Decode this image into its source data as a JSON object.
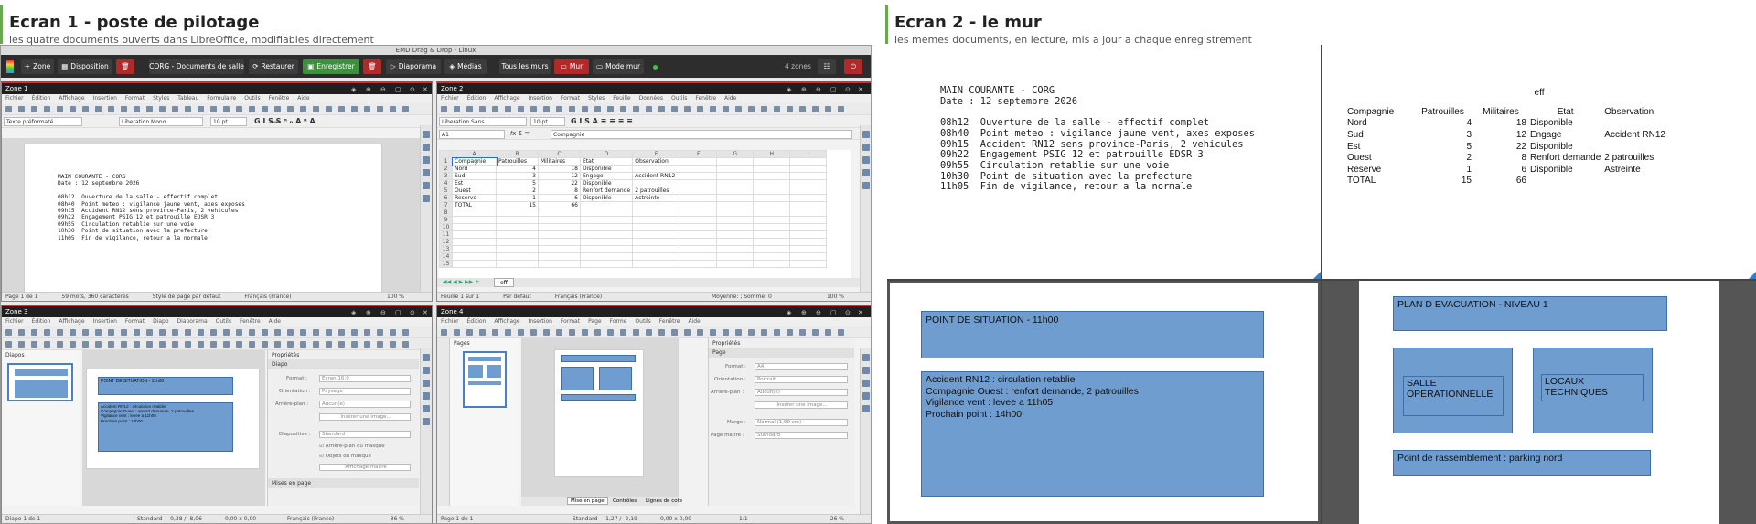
{
  "left_header": {
    "title": "Ecran 1 - poste de pilotage",
    "subtitle": "les quatre documents ouverts dans LibreOffice, modifiables directement"
  },
  "right_header": {
    "title": "Ecran 2 - le mur",
    "subtitle": "les memes documents, en lecture, mis a jour a chaque enregistrement"
  },
  "app": {
    "window_title": "EMD Drag & Drop - Linux",
    "toolbar": {
      "zone": "Zone",
      "disposition": "Disposition",
      "doc_select": "CORG - Documents de salle",
      "restaurer": "Restaurer",
      "enregistrer": "Enregistrer",
      "diaporama": "Diaporama",
      "medias": "Médias",
      "tous_les_murs": "Tous les murs",
      "mur": "Mur",
      "mode_mur": "Mode mur",
      "zone_count": "4 zones"
    },
    "menus_writer": [
      "Fichier",
      "Édition",
      "Affichage",
      "Insertion",
      "Format",
      "Styles",
      "Tableau",
      "Formulaire",
      "Outils",
      "Fenêtre",
      "Aide"
    ],
    "menus_calc": [
      "Fichier",
      "Édition",
      "Affichage",
      "Insertion",
      "Format",
      "Styles",
      "Feuille",
      "Données",
      "Outils",
      "Fenêtre",
      "Aide"
    ],
    "menus_impress": [
      "Fichier",
      "Édition",
      "Affichage",
      "Insertion",
      "Format",
      "Diapo",
      "Diaporama",
      "Outils",
      "Fenêtre",
      "Aide"
    ],
    "menus_draw": [
      "Fichier",
      "Édition",
      "Affichage",
      "Insertion",
      "Format",
      "Page",
      "Forme",
      "Outils",
      "Fenêtre",
      "Aide"
    ],
    "zone1": {
      "label": "Zone 1",
      "para_style": "Texte préformaté",
      "font": "Liberation Mono",
      "size": "10 pt",
      "status": {
        "page": "Page 1 de 1",
        "words": "59 mots, 360 caractères",
        "style": "Style de page par défaut",
        "lang": "Français (France)",
        "zoom": "100 %"
      }
    },
    "zone2": {
      "label": "Zone 2",
      "font": "Liberation Sans",
      "size": "10 pt",
      "cell_ref": "A1",
      "formula": "Compagnie",
      "cols": [
        "A",
        "B",
        "C",
        "D",
        "E",
        "F",
        "G",
        "H",
        "I"
      ],
      "sheet_tab": "eff",
      "status": {
        "sheet": "Feuille 1 sur 1",
        "def": "Par défaut",
        "lang": "Français (France)",
        "calc": "Moyenne: ; Somme: 0",
        "zoom": "100 %"
      }
    },
    "zone3": {
      "label": "Zone 3",
      "slides_title": "Diapos",
      "props_title": "Propriétés",
      "section": "Diapo",
      "fields": [
        {
          "label": "Format :",
          "value": "Écran 16:9"
        },
        {
          "label": "Orientation :",
          "value": "Paysage"
        },
        {
          "label": "Arrière-plan :",
          "value": "Aucun(e)"
        }
      ],
      "insert_image": "Insérer une image...",
      "master_label": "Diapositive :",
      "master_value": "Standard",
      "check1": "Arrière-plan du masque",
      "check2": "Objets du masque",
      "master_btn": "Affichage maître",
      "layouts": "Mises en page",
      "status": {
        "slide": "Diapo 1 de 1",
        "layout": "Standard",
        "pos": "-0,38 / -8,06",
        "size": "0,00 x 0,00",
        "lang": "Français (France)",
        "zoom": "36 %"
      }
    },
    "zone4": {
      "label": "Zone 4",
      "pages_title": "Pages",
      "props_title": "Propriétés",
      "section": "Page",
      "fields": [
        {
          "label": "Format :",
          "value": "A4"
        },
        {
          "label": "Orientation :",
          "value": "Portrait"
        },
        {
          "label": "Arrière-plan :",
          "value": "Aucun(e)"
        }
      ],
      "insert_image": "Insérer une image...",
      "margin_label": "Marge :",
      "margin_value": "Normal (1,90 cm)",
      "master_label": "Page maître :",
      "master_value": "Standard",
      "tabs": [
        "Mise en page",
        "Contrôles",
        "Lignes de cote"
      ],
      "status": {
        "page": "Page 1 de 1",
        "layout": "Standard",
        "pos": "-1,27 / -2,19",
        "size": "0,00 x 0,00",
        "ratio": "1:1",
        "zoom": "26 %"
      }
    }
  },
  "main_courante": {
    "title": "MAIN COURANTE - CORG",
    "date": "Date : 12 septembre 2026",
    "entries": [
      "08h12  Ouverture de la salle - effectif complet",
      "08h40  Point meteo : vigilance jaune vent, axes exposes",
      "09h15  Accident RN12 sens province-Paris, 2 vehicules",
      "09h22  Engagement PSIG 12 et patrouille EDSR 3",
      "09h55  Circulation retablie sur une voie",
      "10h30  Point de situation avec la prefecture",
      "11h05  Fin de vigilance, retour a la normale"
    ]
  },
  "effectifs": {
    "sheet_name": "eff",
    "headers": [
      "Compagnie",
      "Patrouilles",
      "Militaires",
      "Etat",
      "Observation"
    ],
    "rows": [
      [
        "Nord",
        "4",
        "18",
        "Disponible",
        ""
      ],
      [
        "Sud",
        "3",
        "12",
        "Engage",
        "Accident RN12"
      ],
      [
        "Est",
        "5",
        "22",
        "Disponible",
        ""
      ],
      [
        "Ouest",
        "2",
        "8",
        "Renfort demande",
        "2 patrouilles"
      ],
      [
        "Reserve",
        "1",
        "6",
        "Disponible",
        "Astreinte"
      ],
      [
        "TOTAL",
        "15",
        "66",
        "",
        ""
      ]
    ]
  },
  "situation": {
    "title": "POINT DE SITUATION - 11h00",
    "lines": [
      "Accident RN12 : circulation retablie",
      "Compagnie Ouest : renfort demande, 2 patrouilles",
      "Vigilance vent : levee a 11h05",
      "Prochain point : 14h00"
    ]
  },
  "evacuation": {
    "title": "PLAN D EVACUATION - NIVEAU 1",
    "room1": "SALLE OPERATIONNELLE",
    "room2": "LOCAUX TECHNIQUES",
    "assembly": "Point de rassemblement : parking nord"
  },
  "colors": {
    "accent": "#6aa84f",
    "shape_fill": "#6f9dd0",
    "shape_border": "#3f6fa8",
    "save_green": "#3f8f3f",
    "danger_red": "#b02a2a"
  }
}
